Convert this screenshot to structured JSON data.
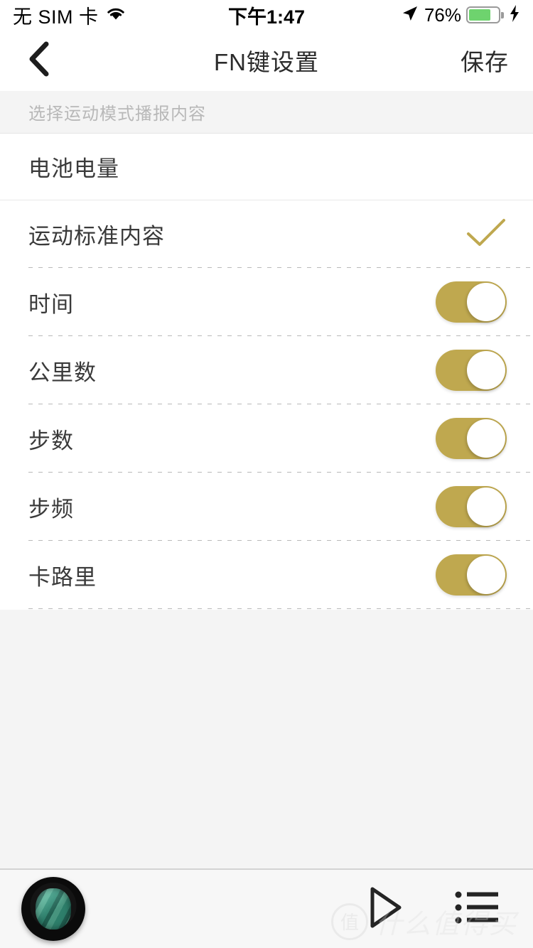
{
  "status_bar": {
    "carrier": "无 SIM 卡",
    "wifi_icon": "wifi-icon",
    "time": "下午1:47",
    "location_icon": "location-arrow-icon",
    "battery_percent": "76%",
    "battery_level": 76,
    "battery_color": "#6ed36e",
    "charging_icon": "lightning-bolt-icon"
  },
  "nav_bar": {
    "back_icon": "chevron-left-icon",
    "title": "FN键设置",
    "save_label": "保存"
  },
  "section": {
    "header": "选择运动模式播报内容"
  },
  "accent_color": "#bfa84f",
  "rows": [
    {
      "label": "电池电量",
      "control": "none"
    },
    {
      "label": "运动标准内容",
      "control": "check",
      "checked": true
    },
    {
      "label": "时间",
      "control": "toggle",
      "on": true
    },
    {
      "label": "公里数",
      "control": "toggle",
      "on": true
    },
    {
      "label": "步数",
      "control": "toggle",
      "on": true
    },
    {
      "label": "步频",
      "control": "toggle",
      "on": true
    },
    {
      "label": "卡路里",
      "control": "toggle",
      "on": true
    }
  ],
  "player_bar": {
    "album_art_name": "album-art",
    "play_icon": "play-icon",
    "playlist_icon": "playlist-icon"
  },
  "watermark": {
    "logo_char": "值",
    "text": "什么值得买"
  }
}
